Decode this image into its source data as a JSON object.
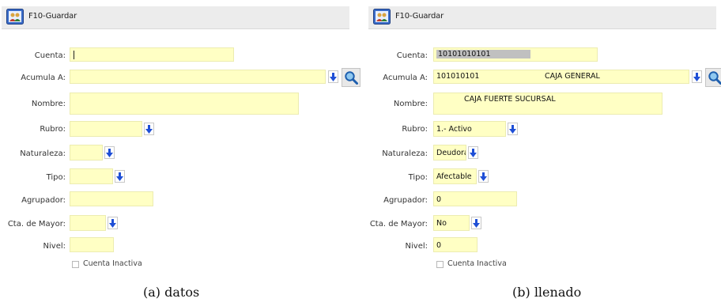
{
  "toolbar": {
    "save_label": "F10-Guardar"
  },
  "labels": {
    "cuenta": "Cuenta:",
    "acumula": "Acumula A:",
    "nombre": "Nombre:",
    "rubro": "Rubro:",
    "naturaleza": "Naturaleza:",
    "tipo": "Tipo:",
    "agrupador": "Agrupador:",
    "cta_mayor": "Cta. de Mayor:",
    "nivel": "Nivel:",
    "inactiva": "Cuenta Inactiva"
  },
  "panel_b": {
    "cuenta": "10101010101",
    "acumula_code": "101010101",
    "acumula_name": "CAJA GENERAL",
    "nombre": "CAJA FUERTE SUCURSAL",
    "rubro": "1.- Activo",
    "naturaleza": "Deudora",
    "tipo": "Afectable",
    "agrupador": "0",
    "cta_mayor": "No",
    "nivel": "0"
  },
  "captions": {
    "a": "(a)  datos",
    "b": "(b)  llenado"
  },
  "colors": {
    "field_bg": "#ffffc4",
    "toolbar_bg": "#ececec",
    "arrow_blue": "#1f4fd6"
  }
}
